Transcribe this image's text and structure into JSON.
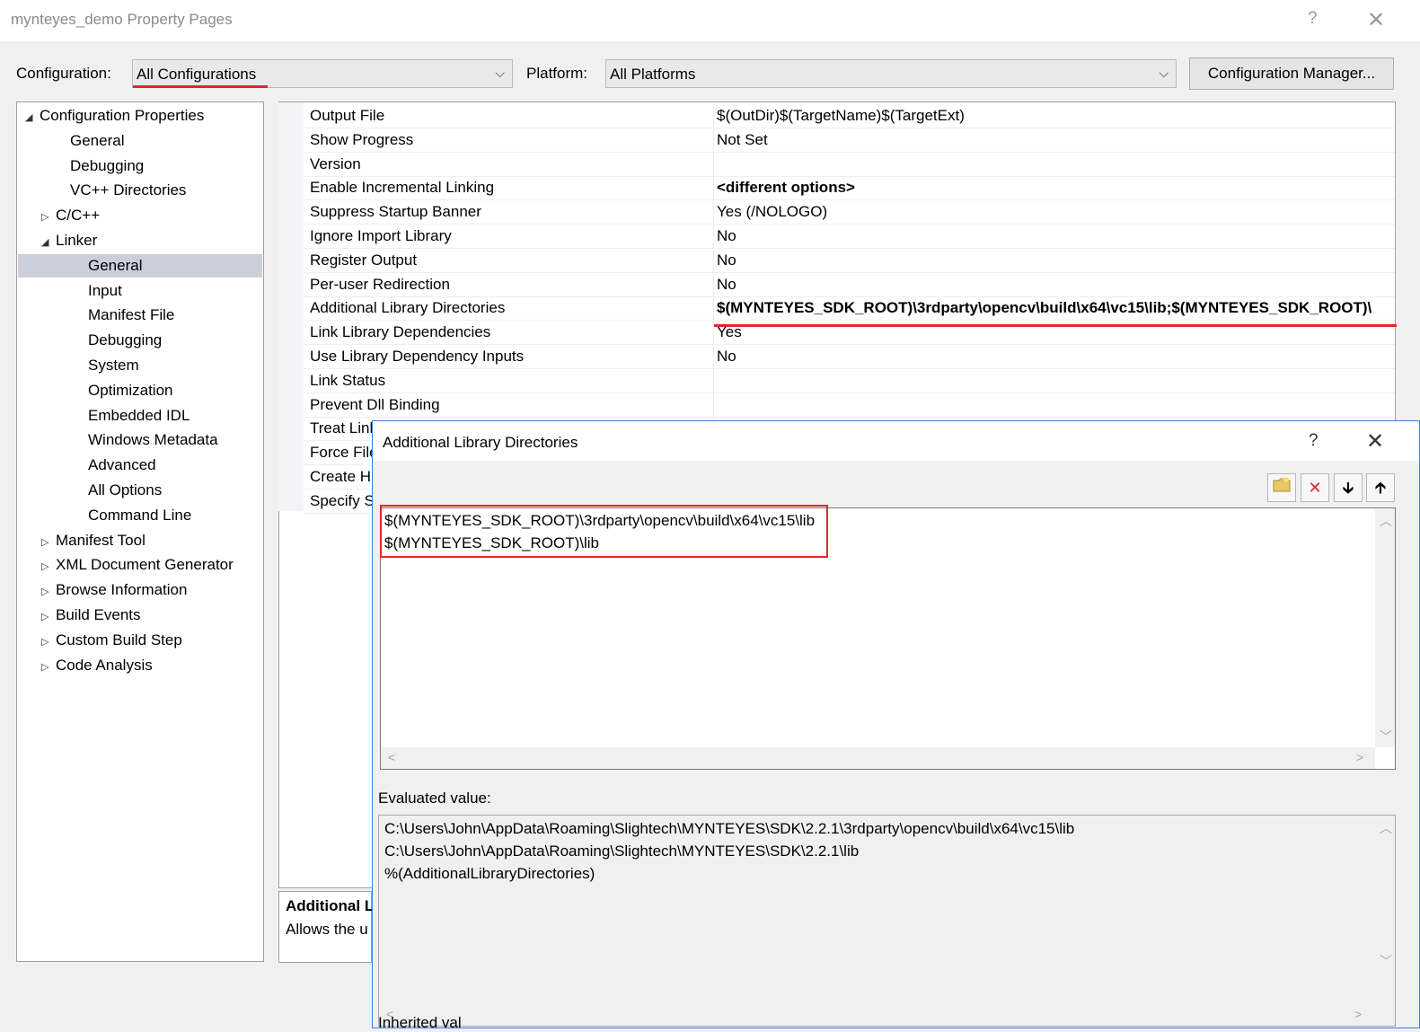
{
  "window": {
    "title": "mynteyes_demo Property Pages",
    "help": "?",
    "close": "✕"
  },
  "toolbar": {
    "configuration_label": "Configuration:",
    "configuration_value": "All Configurations",
    "platform_label": "Platform:",
    "platform_value": "All Platforms",
    "config_manager_label": "Configuration Manager..."
  },
  "tree": {
    "items": [
      {
        "label": "Configuration Properties",
        "expander": "◢"
      },
      {
        "label": "General"
      },
      {
        "label": "Debugging"
      },
      {
        "label": "VC++ Directories"
      },
      {
        "label": "C/C++",
        "expander": "▷"
      },
      {
        "label": "Linker",
        "expander": "◢"
      },
      {
        "label": "General"
      },
      {
        "label": "Input"
      },
      {
        "label": "Manifest File"
      },
      {
        "label": "Debugging"
      },
      {
        "label": "System"
      },
      {
        "label": "Optimization"
      },
      {
        "label": "Embedded IDL"
      },
      {
        "label": "Windows Metadata"
      },
      {
        "label": "Advanced"
      },
      {
        "label": "All Options"
      },
      {
        "label": "Command Line"
      },
      {
        "label": "Manifest Tool",
        "expander": "▷"
      },
      {
        "label": "XML Document Generator",
        "expander": "▷"
      },
      {
        "label": "Browse Information",
        "expander": "▷"
      },
      {
        "label": "Build Events",
        "expander": "▷"
      },
      {
        "label": "Custom Build Step",
        "expander": "▷"
      },
      {
        "label": "Code Analysis",
        "expander": "▷"
      }
    ]
  },
  "properties": {
    "rows": [
      {
        "name": "Output File",
        "value": "$(OutDir)$(TargetName)$(TargetExt)"
      },
      {
        "name": "Show Progress",
        "value": "Not Set"
      },
      {
        "name": "Version",
        "value": ""
      },
      {
        "name": "Enable Incremental Linking",
        "value": "<different options>"
      },
      {
        "name": "Suppress Startup Banner",
        "value": "Yes (/NOLOGO)"
      },
      {
        "name": "Ignore Import Library",
        "value": "No"
      },
      {
        "name": "Register Output",
        "value": "No"
      },
      {
        "name": "Per-user Redirection",
        "value": "No"
      },
      {
        "name": "Additional Library Directories",
        "value": "$(MYNTEYES_SDK_ROOT)\\3rdparty\\opencv\\build\\x64\\vc15\\lib;$(MYNTEYES_SDK_ROOT)\\"
      },
      {
        "name": "Link Library Dependencies",
        "value": "Yes"
      },
      {
        "name": "Use Library Dependency Inputs",
        "value": "No"
      },
      {
        "name": "Link Status",
        "value": ""
      },
      {
        "name": "Prevent Dll Binding",
        "value": ""
      },
      {
        "name": "Treat Link",
        "value": ""
      },
      {
        "name": "Force File",
        "value": ""
      },
      {
        "name": "Create H",
        "value": ""
      },
      {
        "name": "Specify S",
        "value": ""
      }
    ]
  },
  "description": {
    "title": "Additional L",
    "text": "Allows the u"
  },
  "dialog": {
    "title": "Additional Library Directories",
    "help": "?",
    "close": "✕",
    "entries": [
      "$(MYNTEYES_SDK_ROOT)\\3rdparty\\opencv\\build\\x64\\vc15\\lib",
      "$(MYNTEYES_SDK_ROOT)\\lib"
    ],
    "evaluated_label": "Evaluated value:",
    "evaluated": [
      "C:\\Users\\John\\AppData\\Roaming\\Slightech\\MYNTEYES\\SDK\\2.2.1\\3rdparty\\opencv\\build\\x64\\vc15\\lib",
      "C:\\Users\\John\\AppData\\Roaming\\Slightech\\MYNTEYES\\SDK\\2.2.1\\lib",
      "%(AdditionalLibraryDirectories)"
    ],
    "inherited_label": "Inherited val"
  },
  "colors": {
    "highlight_red": "#e1262c",
    "selection": "#cbcfdc",
    "dialog_border": "#3c7fd6"
  }
}
